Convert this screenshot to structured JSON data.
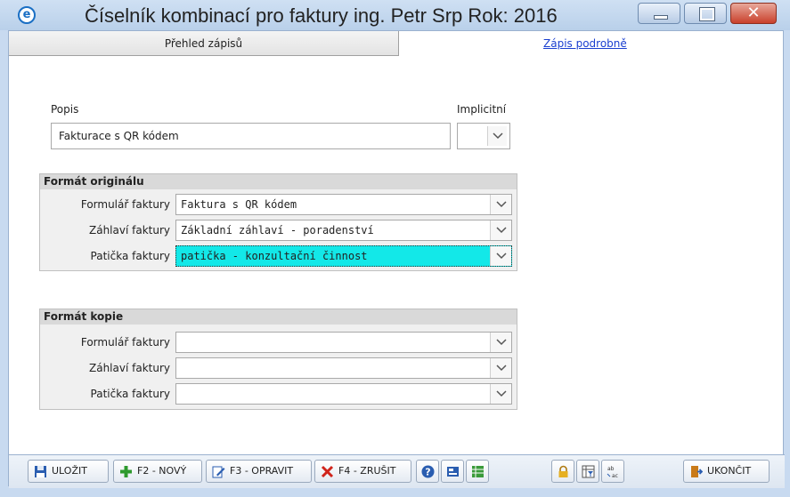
{
  "window": {
    "title": "Číselník kombinací pro faktury  ing. Petr Srp  Rok: 2016",
    "app_icon_glyph": "e"
  },
  "tabs": {
    "overview": "Přehled zápisů",
    "detail": "Zápis podrobně"
  },
  "form": {
    "popis_label": "Popis",
    "popis_value": "Fakturace s QR kódem",
    "implicitni_label": "Implicitní",
    "implicitni_value": ""
  },
  "original": {
    "heading": "Formát originálu",
    "rows": [
      {
        "label": "Formulář faktury",
        "value": "Faktura s QR kódem"
      },
      {
        "label": "Záhlaví faktury",
        "value": "Základní záhlaví - poradenství"
      },
      {
        "label": "Patička faktury",
        "value": "patička - konzultační činnost"
      }
    ]
  },
  "copy": {
    "heading": "Formát kopie",
    "rows": [
      {
        "label": "Formulář faktury",
        "value": ""
      },
      {
        "label": "Záhlaví faktury",
        "value": ""
      },
      {
        "label": "Patička faktury",
        "value": ""
      }
    ]
  },
  "toolbar": {
    "save": "ULOŽIT",
    "new": "F2 - NOVÝ",
    "edit": "F3 - OPRAVIT",
    "cancel": "F4 - ZRUŠIT",
    "exit": "UKONČIT"
  },
  "colors": {
    "highlight": "#13e8e8",
    "link": "#1a3fd0",
    "titlebar": "#c8daf0"
  }
}
